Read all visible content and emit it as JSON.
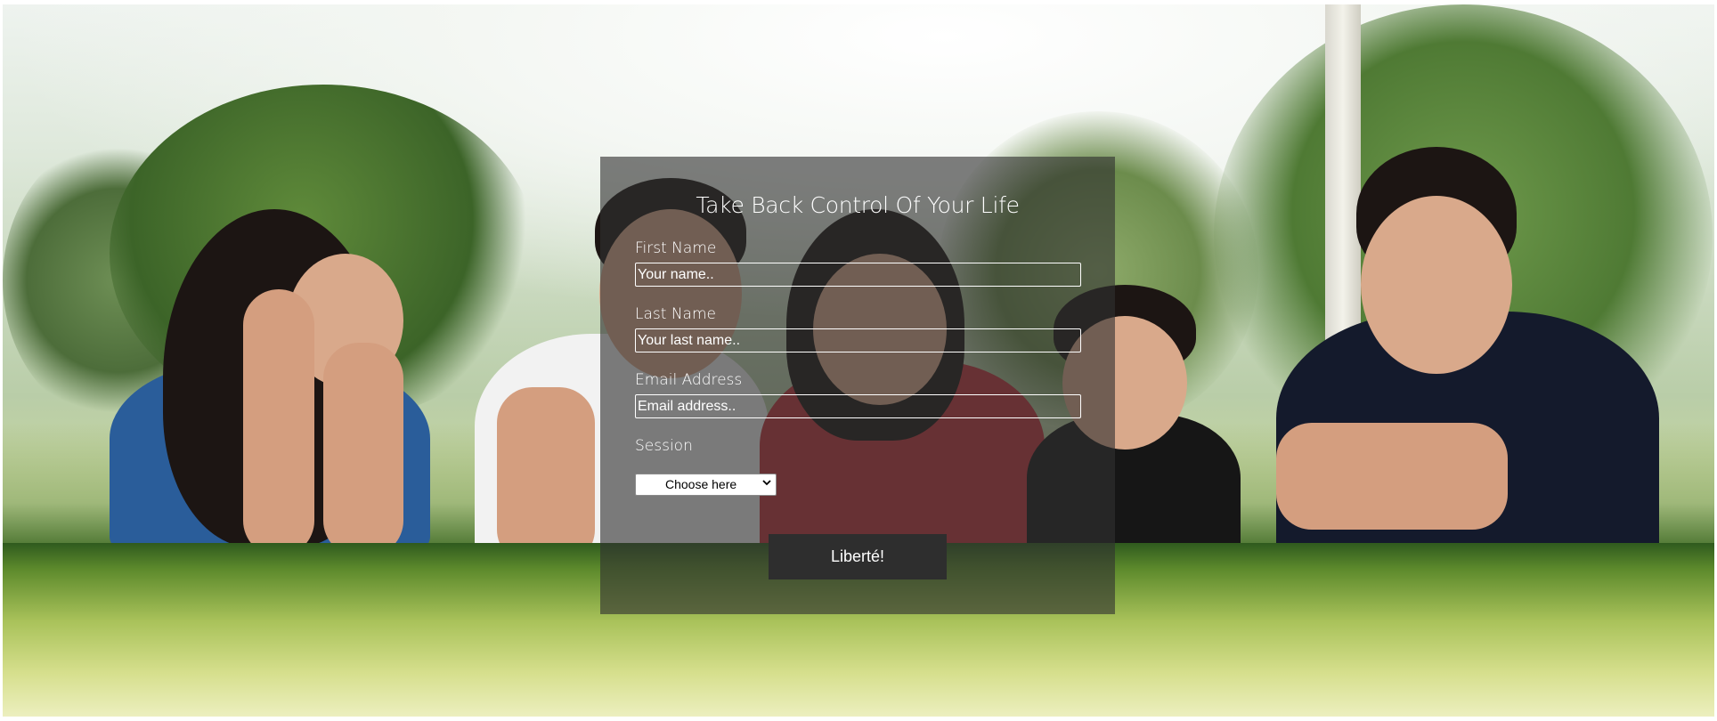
{
  "form": {
    "title": "Take Back Control Of Your Life",
    "fields": [
      {
        "label": "First Name",
        "placeholder": "Your name.."
      },
      {
        "label": "Last Name",
        "placeholder": "Your last name.."
      },
      {
        "label": "Email Address",
        "placeholder": "Email address.."
      }
    ],
    "session": {
      "label": "Session",
      "selected": "Choose here"
    },
    "submit_label": "Liberté!"
  }
}
